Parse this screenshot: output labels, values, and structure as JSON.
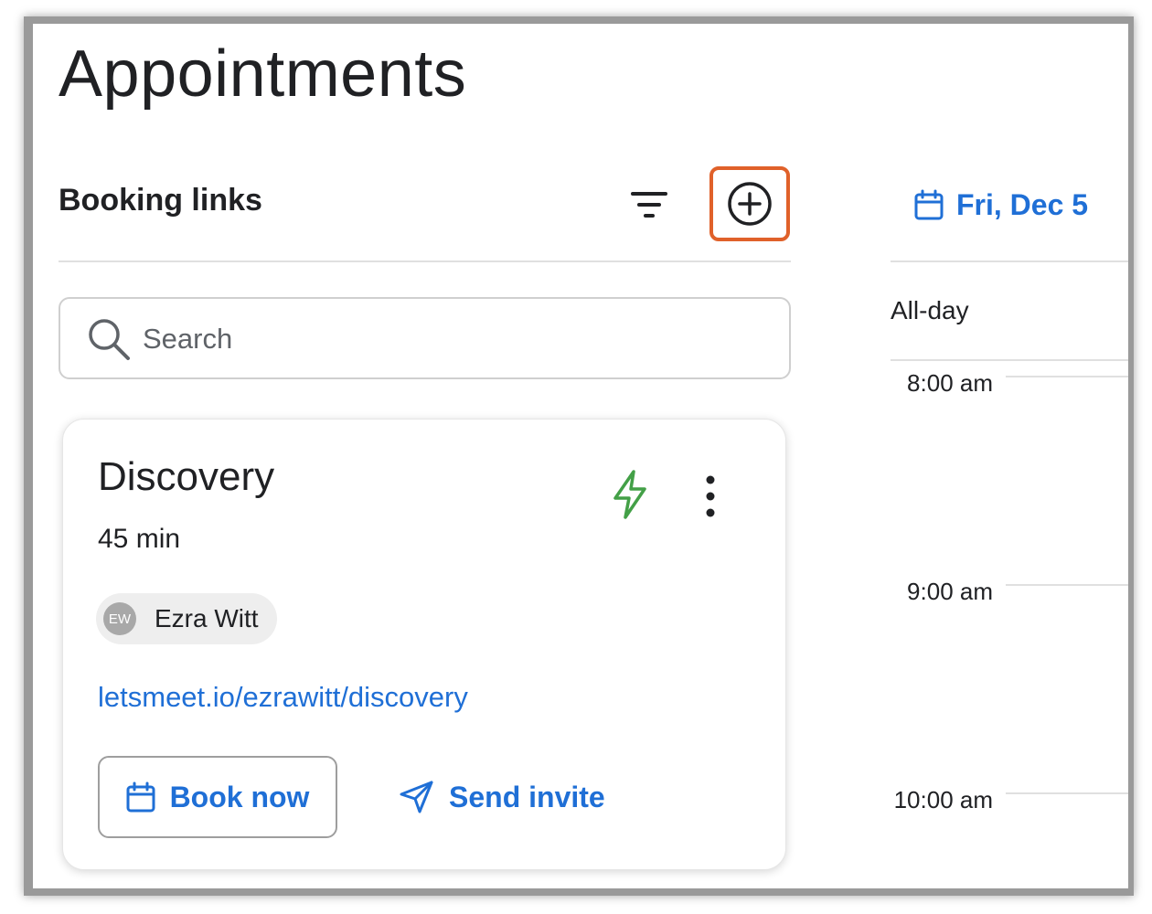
{
  "page": {
    "title": "Appointments"
  },
  "booking_links": {
    "title": "Booking links",
    "filter_icon": "filter-icon",
    "add_icon": "add-circle-icon",
    "highlight_color": "#e0612a"
  },
  "search": {
    "placeholder": "Search",
    "value": ""
  },
  "cards": [
    {
      "title": "Discovery",
      "duration": "45 min",
      "owner_initials": "EW",
      "owner_name": "Ezra Witt",
      "url": "letsmeet.io/ezrawitt/discovery",
      "book_label": "Book now",
      "invite_label": "Send invite",
      "status_icon": "bolt-icon",
      "status_color": "#43a047"
    }
  ],
  "calendar": {
    "date_label": "Fri, Dec 5",
    "all_day_label": "All-day",
    "times": [
      "8:00 am",
      "9:00 am",
      "10:00 am"
    ]
  },
  "colors": {
    "accent": "#1f6fd6",
    "text": "#202124",
    "divider": "#e0e0e0"
  }
}
